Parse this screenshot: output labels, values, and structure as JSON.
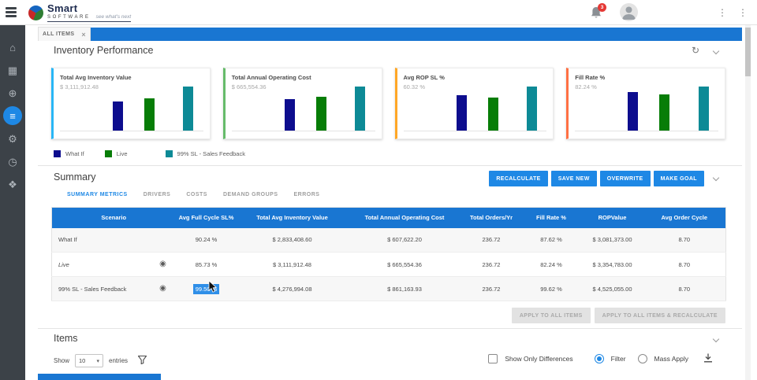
{
  "colors": {
    "primary_blue": "#1976d2",
    "button_blue": "#1e88e5",
    "selection_blue": "#2f8fe8",
    "sidebar_dark": "#3c4248",
    "badge_red": "#e53935"
  },
  "icons": {
    "overflow_menu": "⋮",
    "refresh": "↻",
    "select_caret": "▾",
    "tab_close": "×",
    "goal": "◉"
  },
  "topbar": {
    "brand_name": "Smart",
    "brand_sub": "SOFTWARE",
    "brand_tagline": "see what's next",
    "notification_badge": "3"
  },
  "sidebar": {
    "items": [
      {
        "name": "home",
        "glyph": "⌂",
        "active": false
      },
      {
        "name": "dashboard",
        "glyph": "▦",
        "active": false
      },
      {
        "name": "globe",
        "glyph": "⊕",
        "active": false
      },
      {
        "name": "items-list",
        "glyph": "≡",
        "active": true
      },
      {
        "name": "settings",
        "glyph": "⚙",
        "active": false
      },
      {
        "name": "history",
        "glyph": "◷",
        "active": false
      },
      {
        "name": "network",
        "glyph": "❖",
        "active": false
      }
    ]
  },
  "tabstrip": {
    "active_tab": "ALL ITEMS"
  },
  "inventory": {
    "title": "Inventory Performance",
    "cards": [
      {
        "title": "Total Avg Inventory Value",
        "value": "$ 3,111,912.48",
        "accent": "#29b6f6"
      },
      {
        "title": "Total Annual Operating Cost",
        "value": "$ 665,554.36",
        "accent": "#66bb6a"
      },
      {
        "title": "Avg ROP SL %",
        "value": "60.32 %",
        "accent": "#ffa726"
      },
      {
        "title": "Fill Rate %",
        "value": "82.24 %",
        "accent": "#ff7043"
      }
    ],
    "legend": [
      {
        "label": "What If",
        "color": "#0d0d8e"
      },
      {
        "label": "Live",
        "color": "#077d07"
      },
      {
        "label": "99% SL - Sales Feedback",
        "color": "#0d8a96"
      }
    ]
  },
  "chart_data": [
    {
      "type": "bar",
      "title": "Total Avg Inventory Value",
      "displayed_value": "$ 3,111,912.48",
      "categories": [
        "What If",
        "Live",
        "99% SL - Sales Feedback"
      ],
      "values": [
        2833408.6,
        3111912.48,
        4276994.08
      ],
      "grid": false,
      "legend_position": "below"
    },
    {
      "type": "bar",
      "title": "Total Annual Operating Cost",
      "displayed_value": "$ 665,554.36",
      "categories": [
        "What If",
        "Live",
        "99% SL - Sales Feedback"
      ],
      "values": [
        607622.2,
        665554.36,
        861163.93
      ],
      "grid": false,
      "legend_position": "below"
    },
    {
      "type": "bar",
      "title": "Avg ROP SL %",
      "displayed_value": "60.32 %",
      "categories": [
        "What If",
        "Live",
        "99% SL - Sales Feedback"
      ],
      "values": [
        64,
        60.32,
        80
      ],
      "grid": false,
      "legend_position": "below"
    },
    {
      "type": "bar",
      "title": "Fill Rate %",
      "displayed_value": "82.24 %",
      "categories": [
        "What If",
        "Live",
        "99% SL - Sales Feedback"
      ],
      "values": [
        87.62,
        82.24,
        99.62
      ],
      "grid": false,
      "legend_position": "below"
    }
  ],
  "summary": {
    "title": "Summary",
    "buttons": [
      "RECALCULATE",
      "SAVE NEW",
      "OVERWRITE",
      "MAKE GOAL"
    ],
    "tabs": [
      "SUMMARY METRICS",
      "DRIVERS",
      "COSTS",
      "DEMAND GROUPS",
      "ERRORS"
    ],
    "active_tab": "SUMMARY METRICS",
    "table": {
      "columns": [
        "Scenario",
        "Avg Full Cycle SL%",
        "Total Avg Inventory Value",
        "Total Annual Operating Cost",
        "Total Orders/Yr",
        "Fill Rate %",
        "ROPValue",
        "Avg Order Cycle"
      ],
      "rows": [
        {
          "scenario": "What If",
          "goal": false,
          "sl": "90.24 %",
          "inventory": "$ 2,833,408.60",
          "cost": "$ 607,622.20",
          "orders": "236.72",
          "fill": "87.62 %",
          "rop": "$ 3,081,373.00",
          "cycle": "8.70"
        },
        {
          "scenario": "Live",
          "goal": true,
          "sl": "85.73 %",
          "inventory": "$ 3,111,912.48",
          "cost": "$ 665,554.36",
          "orders": "236.72",
          "fill": "82.24 %",
          "rop": "$ 3,354,783.00",
          "cycle": "8.70"
        },
        {
          "scenario": "99% SL - Sales Feedback",
          "goal": true,
          "sl": "99.50 %",
          "inventory": "$ 4,276,994.08",
          "cost": "$ 861,163.93",
          "orders": "236.72",
          "fill": "99.62 %",
          "rop": "$ 4,525,055.00",
          "cycle": "8.70"
        }
      ],
      "selected_cell": {
        "row": "99% SL - Sales Feedback",
        "column": "Avg Full Cycle SL%",
        "value": "99.50 %"
      }
    },
    "apply_buttons": [
      "APPLY TO ALL ITEMS",
      "APPLY TO ALL ITEMS & RECALCULATE"
    ]
  },
  "items": {
    "title": "Items",
    "show_label": "Show",
    "page_size": "10",
    "entries_label": "entries",
    "diff_checkbox_label": "Show Only Differences",
    "filter_radio_label": "Filter",
    "filter_radio_selected": true,
    "mass_apply_radio_label": "Mass Apply",
    "mass_apply_radio_selected": false
  }
}
